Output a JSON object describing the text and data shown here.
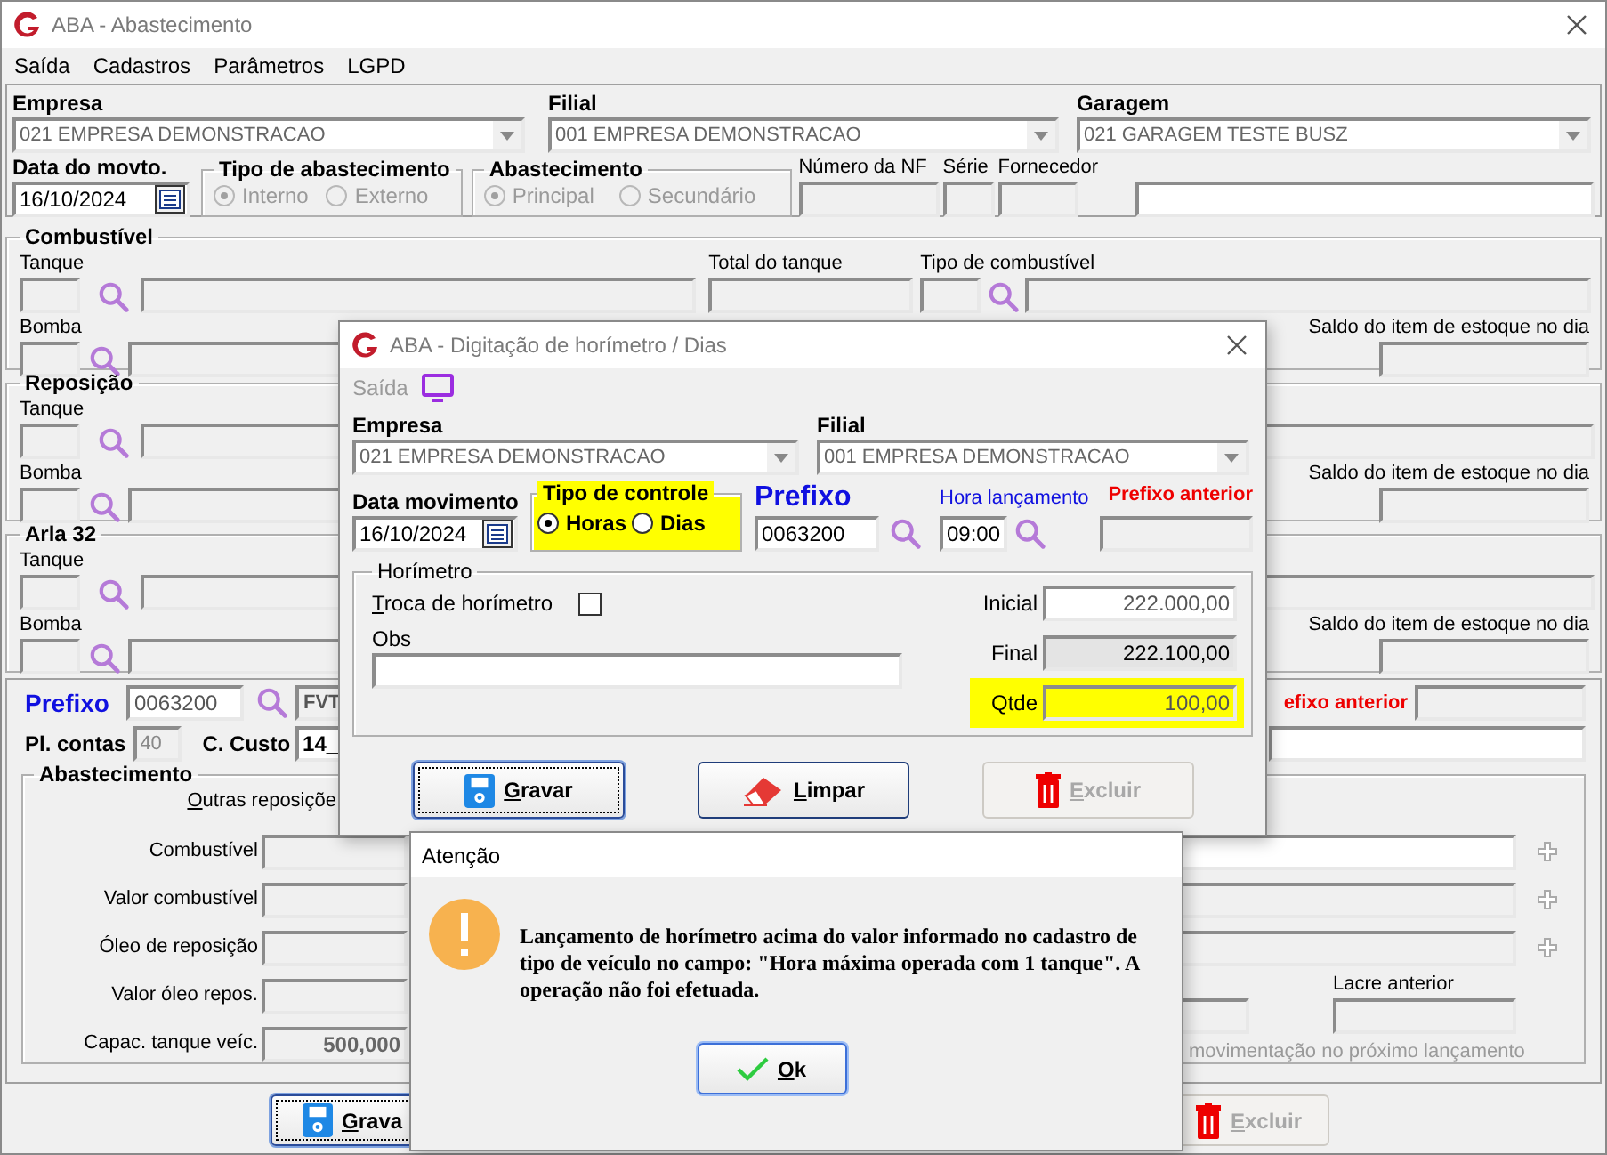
{
  "window": {
    "title": "ABA - Abastecimento"
  },
  "menu": [
    {
      "label": "Saída"
    },
    {
      "label": "Cadastros"
    },
    {
      "label": "Parâmetros"
    },
    {
      "label": "LGPD"
    }
  ],
  "header": {
    "company": {
      "label": "Empresa",
      "value": "021 EMPRESA DEMONSTRACAO"
    },
    "branch": {
      "label": "Filial",
      "value": "001 EMPRESA DEMONSTRACAO"
    },
    "garage": {
      "label": "Garagem",
      "value": "021 GARAGEM TESTE BUSZ"
    },
    "date": {
      "label": "Data do movto.",
      "value": "16/10/2024"
    },
    "supply_type": {
      "label": "Tipo de abastecimento",
      "options": [
        {
          "label": "Interno",
          "selected": true,
          "disabled": true
        },
        {
          "label": "Externo",
          "selected": false,
          "disabled": true
        }
      ]
    },
    "supply": {
      "label": "Abastecimento",
      "options": [
        {
          "label": "Principal",
          "selected": true,
          "disabled": true
        },
        {
          "label": "Secundário",
          "selected": false,
          "disabled": true
        }
      ]
    },
    "nf_label": "Número da NF",
    "series_label": "Série",
    "supplier_label": "Fornecedor"
  },
  "sections": [
    {
      "title": "Combustível",
      "tank_label": "Tanque",
      "pump_label": "Bomba",
      "tank_total_label": "Total do tanque",
      "fuel_type_label": "Tipo de combustível",
      "stock_label": "Saldo do item de estoque no dia"
    },
    {
      "title": "Reposição",
      "tank_label": "Tanque",
      "pump_label": "Bomba",
      "stock_label": "Saldo do item de estoque no dia"
    },
    {
      "title": "Arla 32",
      "tank_label": "Tanque",
      "pump_label": "Bomba",
      "stock_label": "Saldo do item de estoque no dia"
    }
  ],
  "vehicle": {
    "prefix_label": "Prefixo",
    "prefix_value": "0063200",
    "description": "FVT",
    "previous_prefix_label": "efixo anterior",
    "accounts_label": "Pl. contas",
    "accounts_value": "40",
    "cost_center_label": "C. Custo",
    "cost_center_value": "14_"
  },
  "supply_group": {
    "title": "Abastecimento",
    "other_label": "Outras reposiçõe",
    "fields": [
      {
        "label": "Combustível"
      },
      {
        "label": "Valor combustível"
      },
      {
        "label": "Óleo de reposição"
      },
      {
        "label": "Valor óleo repos."
      },
      {
        "label": "Capac. tanque veíc.",
        "value": "500,000"
      }
    ],
    "seal_label": "Lacre anterior",
    "note": "movimentação no próximo lançamento"
  },
  "buttons": [
    {
      "label": "Grava",
      "kind": "save",
      "disabled": false
    },
    {
      "label": "Excluir",
      "kind": "delete",
      "disabled": true
    }
  ],
  "hour_dialog": {
    "title": "ABA - Digitação de horímetro / Dias",
    "menu": "Saída",
    "company": {
      "label": "Empresa",
      "value": "021 EMPRESA DEMONSTRACAO"
    },
    "branch": {
      "label": "Filial",
      "value": "001 EMPRESA DEMONSTRACAO"
    },
    "date": {
      "label": "Data movimento",
      "value": "16/10/2024"
    },
    "control_type": {
      "label": "Tipo de controle",
      "highlighted": true,
      "options": [
        {
          "label": "Horas",
          "selected": true
        },
        {
          "label": "Dias",
          "selected": false
        }
      ]
    },
    "prefix": {
      "label": "Prefixo",
      "value": "0063200"
    },
    "hour": {
      "label": "Hora lançamento",
      "value": "09:00"
    },
    "previous_prefix_label": "Prefixo anterior",
    "meter": {
      "title": "Horímetro",
      "swap": {
        "label": "Troca de horímetro",
        "checked": false
      },
      "obs_label": "Obs",
      "initial": {
        "label": "Inicial",
        "value": "222.000,00"
      },
      "final": {
        "label": "Final",
        "value": "222.100,00"
      },
      "qty": {
        "label": "Qtde",
        "value": "100,00",
        "highlighted": true
      }
    },
    "buttons": [
      {
        "label": "Gravar",
        "kind": "save",
        "disabled": false
      },
      {
        "label": "Limpar",
        "kind": "clear",
        "disabled": false
      },
      {
        "label": "Excluir",
        "kind": "delete",
        "disabled": true
      }
    ]
  },
  "alert": {
    "title": "Atenção",
    "message": "Lançamento de horímetro acima do valor informado no cadastro de tipo de veículo no campo: \"Hora máxima operada com 1 tanque\". A operação não foi efetuada.",
    "button": "Ok"
  }
}
